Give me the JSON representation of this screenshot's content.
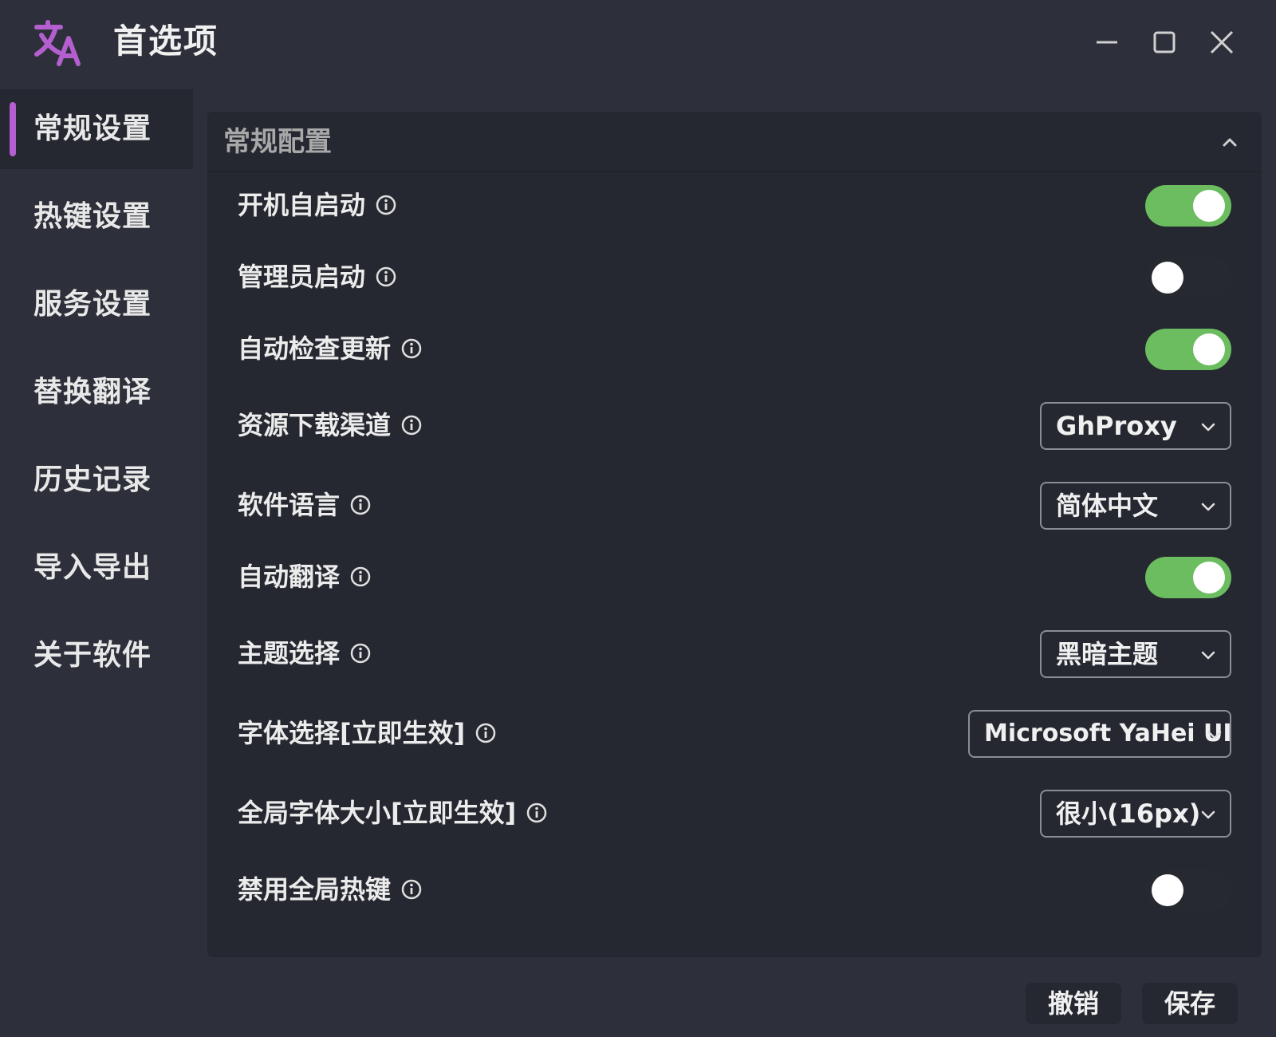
{
  "window": {
    "title": "首选项",
    "logo_icon": "translate-icon",
    "controls": [
      "minimize-icon",
      "maximize-icon",
      "close-icon"
    ]
  },
  "sidebar": {
    "items": [
      {
        "label": "常规设置",
        "active": true
      },
      {
        "label": "热键设置",
        "active": false
      },
      {
        "label": "服务设置",
        "active": false
      },
      {
        "label": "替换翻译",
        "active": false
      },
      {
        "label": "历史记录",
        "active": false
      },
      {
        "label": "导入导出",
        "active": false
      },
      {
        "label": "关于软件",
        "active": false
      }
    ]
  },
  "panel": {
    "title": "常规配置",
    "rows": [
      {
        "label": "开机自启动",
        "type": "toggle",
        "on": true
      },
      {
        "label": "管理员启动",
        "type": "toggle",
        "on": false
      },
      {
        "label": "自动检查更新",
        "type": "toggle",
        "on": true
      },
      {
        "label": "资源下载渠道",
        "type": "select",
        "value": "GhProxy"
      },
      {
        "label": "软件语言",
        "type": "select",
        "value": "简体中文"
      },
      {
        "label": "自动翻译",
        "type": "toggle",
        "on": true
      },
      {
        "label": "主题选择",
        "type": "select",
        "value": "黑暗主题"
      },
      {
        "label": "字体选择[立即生效]",
        "type": "select",
        "value": "Microsoft YaHei UI"
      },
      {
        "label": "全局字体大小[立即生效]",
        "type": "select",
        "value": "很小(16px)"
      },
      {
        "label": "禁用全局热键",
        "type": "toggle",
        "on": false
      }
    ]
  },
  "footer": {
    "cancel_label": "撤销",
    "save_label": "保存"
  },
  "colors": {
    "accent": "#b45fd0",
    "toggle_on": "#6cbd5f",
    "background": "#2d303a",
    "panel": "#252830"
  }
}
